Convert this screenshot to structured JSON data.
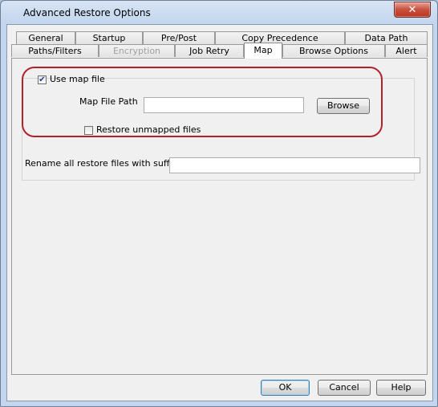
{
  "window": {
    "title": "Advanced Restore Options",
    "close_glyph": "✕"
  },
  "tabs": {
    "row1": [
      {
        "label": "General"
      },
      {
        "label": "Startup"
      },
      {
        "label": "Pre/Post"
      },
      {
        "label": "Copy Precedence"
      },
      {
        "label": "Data Path"
      }
    ],
    "row2": [
      {
        "label": "Paths/Filters"
      },
      {
        "label": "Encryption",
        "disabled": true
      },
      {
        "label": "Job Retry"
      },
      {
        "label": "Map",
        "selected": true
      },
      {
        "label": "Browse Options"
      },
      {
        "label": "Alert"
      }
    ]
  },
  "map_panel": {
    "use_map_file": {
      "label": "Use map file",
      "checked": true,
      "check_glyph": "✔"
    },
    "map_file_path": {
      "label": "Map File Path",
      "value": "",
      "browse_label": "Browse"
    },
    "restore_unmapped": {
      "label": "Restore unmapped files",
      "checked": false
    }
  },
  "rename": {
    "label": "Rename all restore files with suffix",
    "value": ""
  },
  "footer": {
    "ok_label": "OK",
    "cancel_label": "Cancel",
    "help_label": "Help"
  },
  "annotation": {
    "color": "#b4202a"
  }
}
